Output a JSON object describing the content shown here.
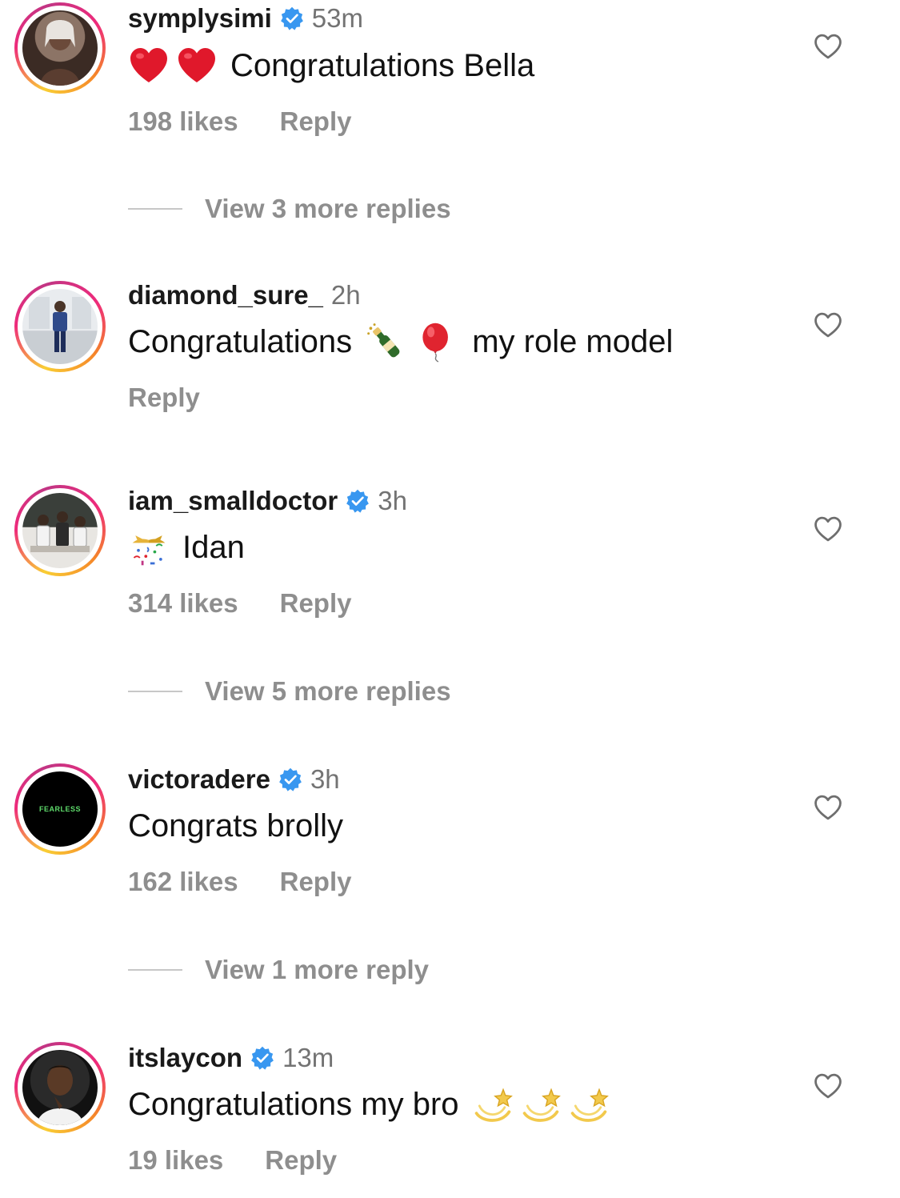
{
  "comments": [
    {
      "username": "symplysimi",
      "verified": true,
      "time": "53m",
      "text": "Congratulations Bella",
      "emojis": [
        "red-heart",
        "red-heart"
      ],
      "likes": "198 likes",
      "reply": "Reply",
      "view_replies": "View 3 more replies"
    },
    {
      "username": "diamond_sure_",
      "verified": false,
      "time": "2h",
      "text_before": "Congratulations",
      "emojis": [
        "champagne",
        "balloon"
      ],
      "text_after": "my role model",
      "reply": "Reply"
    },
    {
      "username": "iam_smalldoctor",
      "verified": true,
      "time": "3h",
      "emojis": [
        "confetti-ball"
      ],
      "text": "Idan",
      "likes": "314 likes",
      "reply": "Reply",
      "view_replies": "View 5 more replies"
    },
    {
      "username": "victoradere",
      "verified": true,
      "time": "3h",
      "text": "Congrats brolly",
      "avatar_text": "FEARLESS",
      "likes": "162 likes",
      "reply": "Reply",
      "view_replies": "View 1 more reply"
    },
    {
      "username": "itslaycon",
      "verified": true,
      "time": "13m",
      "text": "Congratulations my bro",
      "emojis": [
        "dizzy",
        "dizzy",
        "dizzy"
      ],
      "likes": "19 likes",
      "reply": "Reply"
    }
  ],
  "colors": {
    "verified_blue": "#3897f0",
    "muted_text": "#8e8e8e",
    "time_text": "#737373",
    "ring_gradient": [
      "#f9ce34",
      "#ee2a7b",
      "#c13584"
    ]
  }
}
